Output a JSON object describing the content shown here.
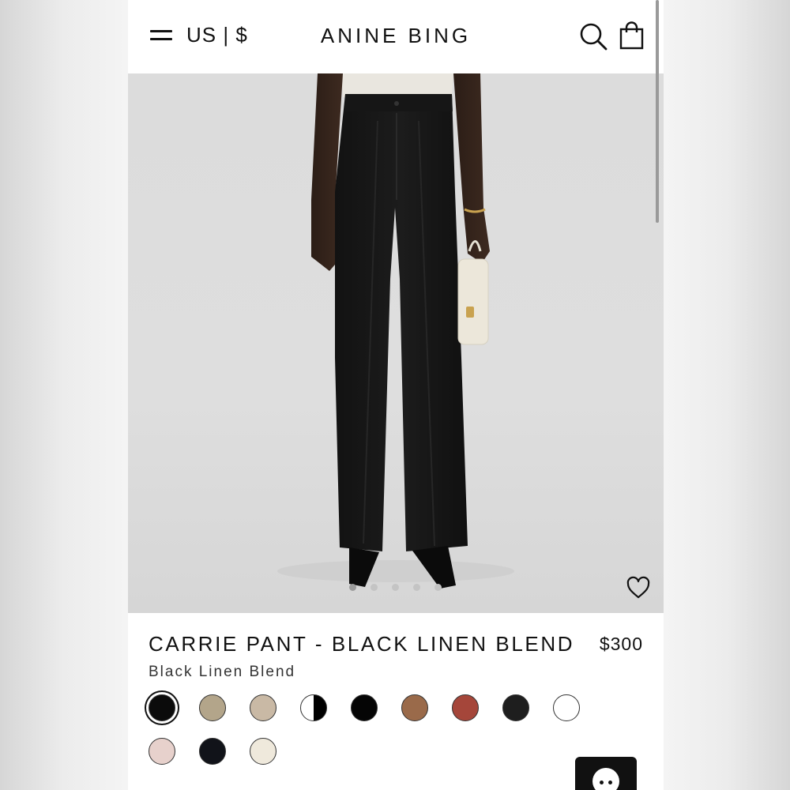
{
  "header": {
    "menu_icon": "hamburger-menu-icon",
    "currency": "US | $",
    "brand": "ANINE BING",
    "search_icon": "search-icon",
    "cart_icon": "shopping-bag-icon"
  },
  "gallery": {
    "image_count": 5,
    "active_index": 0,
    "wishlist_icon": "heart-icon"
  },
  "product": {
    "title": "CARRIE PANT - BLACK LINEN BLEND",
    "price": "$300",
    "color_name": "Black Linen Blend"
  },
  "swatches": [
    {
      "color": "#0b0b0b",
      "selected": true
    },
    {
      "color": "#b3a58a"
    },
    {
      "color": "#c9b9a5"
    },
    {
      "color": "split-black-white"
    },
    {
      "color": "#050505"
    },
    {
      "color": "#9a6a4a"
    },
    {
      "color": "#a5463a"
    },
    {
      "color": "#1e1e1e"
    },
    {
      "color": "#ffffff"
    },
    {
      "color": "#e7d1cc"
    },
    {
      "color": "#111319"
    },
    {
      "color": "#efe9dc"
    }
  ],
  "chat": {
    "icon": "chat-icon"
  }
}
